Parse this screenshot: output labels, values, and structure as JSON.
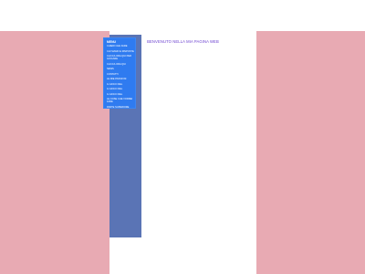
{
  "page": {
    "title": "BENVENUTO NELLA MIA PAGINA WEB"
  },
  "menu": {
    "title": "MENU",
    "items": [
      {
        "label": "CHIEDI CHE FARE"
      },
      {
        "label": "CHI SIAMO E RISPOSTE"
      },
      {
        "label": "CLICCA ORA QUI PER GIOCARE"
      },
      {
        "label": "CLICCA ORA QUI"
      },
      {
        "label": "NEWS"
      },
      {
        "label": "CONTATTI"
      },
      {
        "label": "LE MIE PASSIONI"
      },
      {
        "label": "IL GIOCO DEL"
      },
      {
        "label": "IL GIOCO DEL"
      },
      {
        "label": "IL GIOCO DEL"
      },
      {
        "label": "LE COSE CHE VORREI FARE"
      },
      {
        "label": "PARTE SUPERIORE"
      }
    ]
  },
  "colors": {
    "page_background": "#e8aab3",
    "content_background": "#ffffff",
    "sidebar_background": "#5a74b5",
    "menu_background": "#2f7bf0",
    "title_color": "#6a3fcf"
  }
}
